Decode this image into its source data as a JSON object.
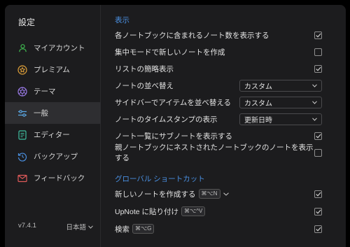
{
  "sidebar": {
    "title": "設定",
    "items": [
      {
        "label": "マイアカウント"
      },
      {
        "label": "プレミアム"
      },
      {
        "label": "テーマ"
      },
      {
        "label": "一般"
      },
      {
        "label": "エディター"
      },
      {
        "label": "バックアップ"
      },
      {
        "label": "フィードバック"
      }
    ],
    "version": "v7.4.1",
    "language": "日本語"
  },
  "display": {
    "title": "表示",
    "rows": [
      {
        "label": "各ノートブックに含まれるノート数を表示する",
        "checked": true
      },
      {
        "label": "集中モードで新しいノートを作成",
        "checked": false
      },
      {
        "label": "リストの簡略表示",
        "checked": true
      },
      {
        "label": "ノートの並べ替え",
        "select": "カスタム"
      },
      {
        "label": "サイドバーでアイテムを並べ替える",
        "select": "カスタム"
      },
      {
        "label": "ノートのタイムスタンプの表示",
        "select": "更新日時"
      },
      {
        "label": "ノート一覧にサブノートを表示する",
        "checked": true
      },
      {
        "label": "親ノートブックにネストされたノートブックのノートを表示する",
        "checked": false
      }
    ]
  },
  "shortcuts": {
    "title": "グローバル ショートカット",
    "rows": [
      {
        "label": "新しいノートを作成する",
        "key": "⌘⌥N",
        "checked": true
      },
      {
        "label": "UpNote に貼り付け",
        "key": "⌘⌥^V",
        "checked": true
      },
      {
        "label": "検索",
        "key": "⌘⌥G",
        "checked": true
      }
    ]
  },
  "colors": {
    "accent": "#4a90e2",
    "background": "#1c1c1e"
  }
}
